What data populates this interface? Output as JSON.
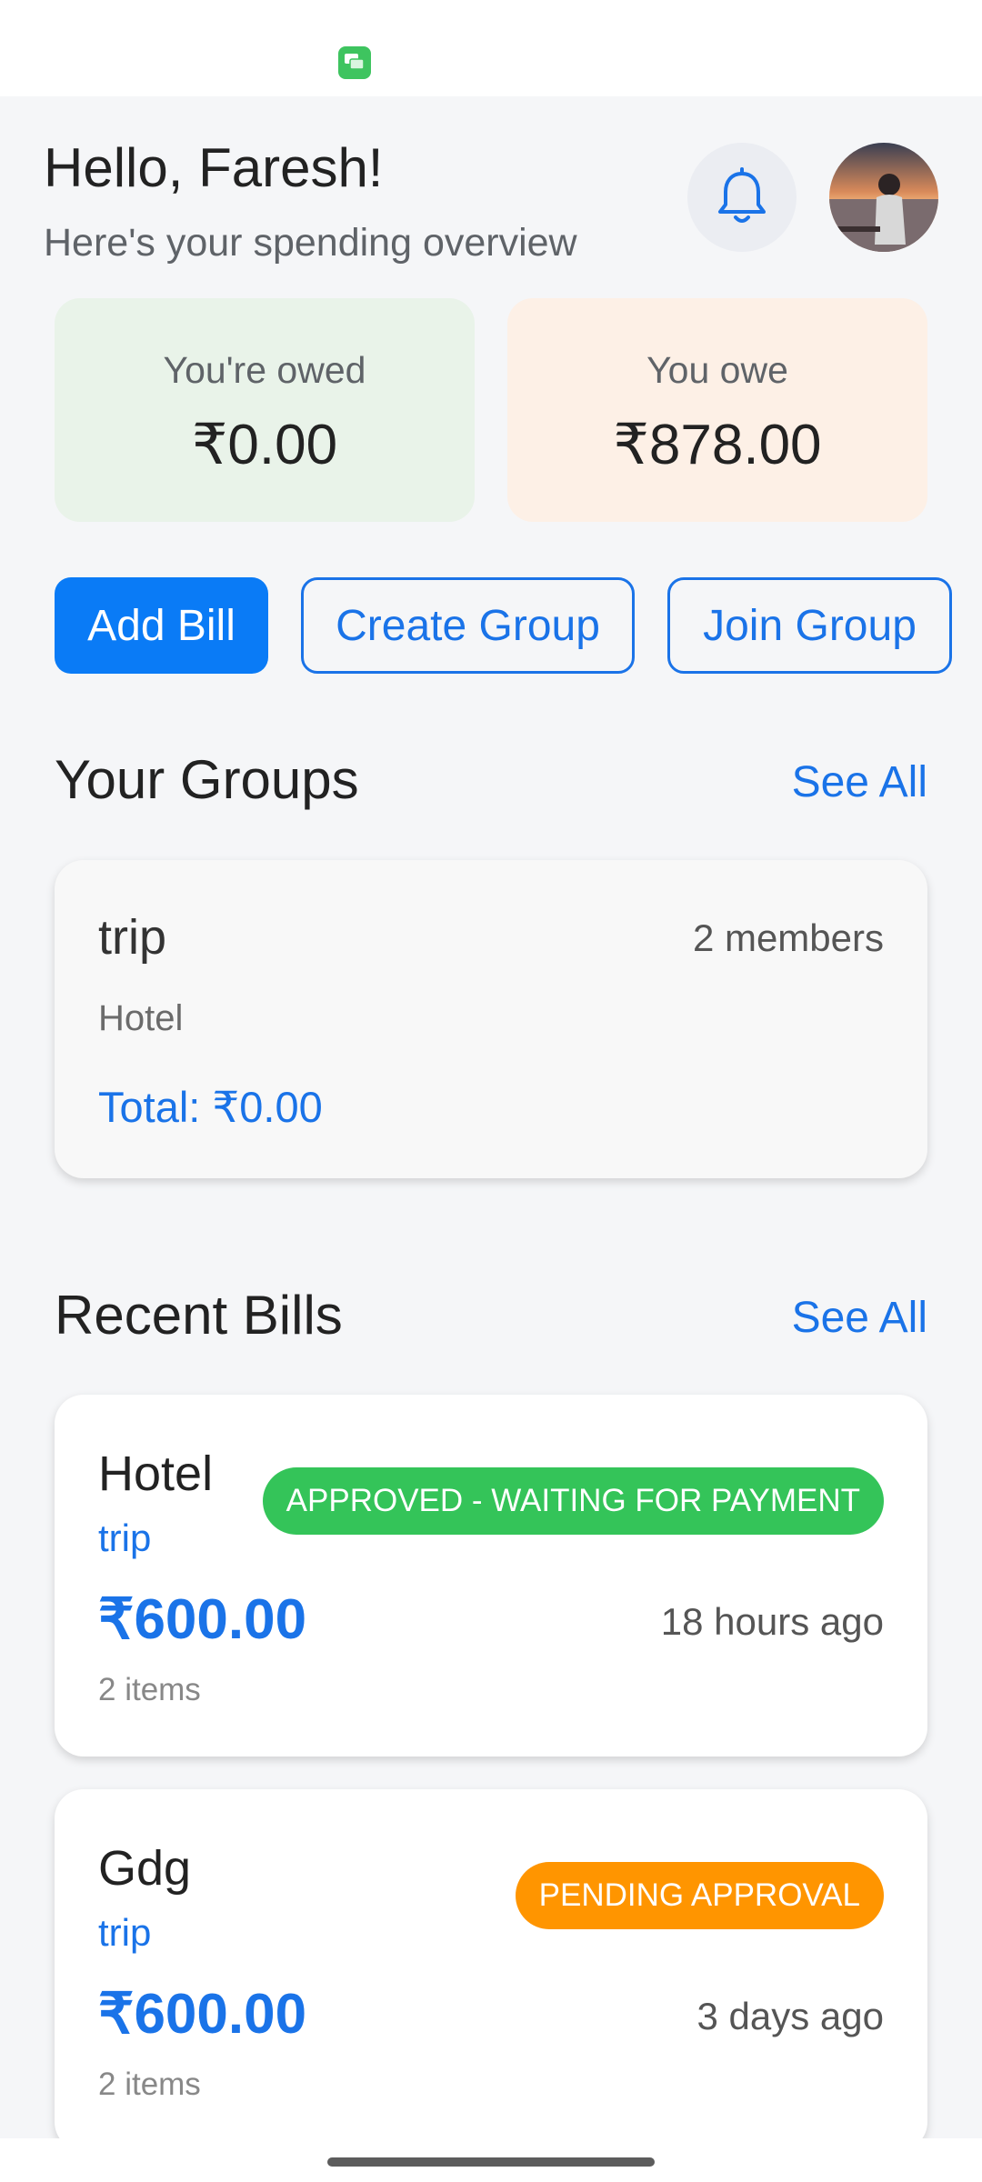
{
  "header": {
    "greeting": "Hello, Faresh!",
    "subtitle": "Here's your spending overview"
  },
  "balances": {
    "owed": {
      "label": "You're owed",
      "amount": "₹0.00"
    },
    "owe": {
      "label": "You owe",
      "amount": "₹878.00"
    }
  },
  "actions": {
    "add_bill": "Add Bill",
    "create_group": "Create Group",
    "join_group": "Join Group"
  },
  "groups_section": {
    "title": "Your Groups",
    "see_all": "See All",
    "groups": [
      {
        "name": "trip",
        "members": "2 members",
        "description": "Hotel",
        "total": "Total: ₹0.00"
      }
    ]
  },
  "bills_section": {
    "title": "Recent Bills",
    "see_all": "See All",
    "bills": [
      {
        "title": "Hotel",
        "group": "trip",
        "status": "APPROVED - WAITING FOR PAYMENT",
        "amount": "₹600.00",
        "time": "18 hours ago",
        "items": "2 items"
      },
      {
        "title": "Gdg",
        "group": "trip",
        "status": "PENDING APPROVAL",
        "amount": "₹600.00",
        "time": "3 days ago",
        "items": "2 items"
      }
    ]
  },
  "colors": {
    "accent": "#1a73e8",
    "primary_button": "#0a7bf6",
    "status_approved": "#34c459",
    "status_pending": "#ff9500",
    "owed_card": "#e9f3e9",
    "owe_card": "#fdf0e6"
  },
  "icons": {
    "status_bar": "messages-app-icon",
    "notifications": "bell-icon",
    "profile": "avatar-photo"
  }
}
